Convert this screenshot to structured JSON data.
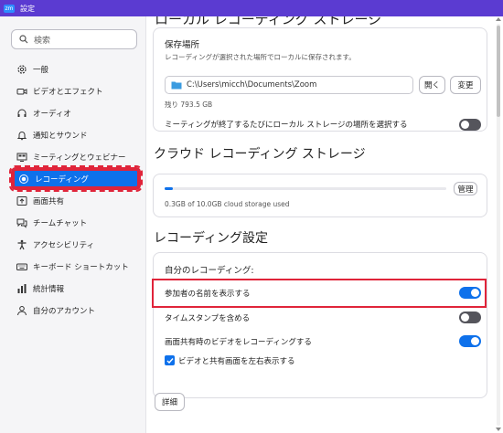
{
  "window": {
    "app_icon_text": "zm",
    "title": "設定"
  },
  "sidebar": {
    "search_placeholder": "検索",
    "items": [
      {
        "label": "一般",
        "icon": "gear-icon"
      },
      {
        "label": "ビデオとエフェクト",
        "icon": "video-camera-icon"
      },
      {
        "label": "オーディオ",
        "icon": "headphones-icon"
      },
      {
        "label": "通知とサウンド",
        "icon": "bell-icon"
      },
      {
        "label": "ミーティングとウェビナー",
        "icon": "meeting-icon"
      },
      {
        "label": "レコーディング",
        "icon": "record-icon",
        "active": true
      },
      {
        "label": "画面共有",
        "icon": "screen-share-icon"
      },
      {
        "label": "チームチャット",
        "icon": "chat-icon"
      },
      {
        "label": "アクセシビリティ",
        "icon": "accessibility-icon"
      },
      {
        "label": "キーボード ショートカット",
        "icon": "keyboard-icon"
      },
      {
        "label": "統計情報",
        "icon": "statistics-icon"
      },
      {
        "label": "自分のアカウント",
        "icon": "account-icon"
      }
    ]
  },
  "local": {
    "cut_heading": "ローカル レコーディング ストレージ",
    "title": "保存場所",
    "description": "レコーディングが選択された場所でローカルに保存されます。",
    "path": "C:\\Users\\micch\\Documents\\Zoom",
    "open_button": "開く",
    "change_button": "変更",
    "remaining": "残り 793.5 GB",
    "choose_location_label": "ミーティングが終了するたびにローカル ストレージの場所を選択する",
    "choose_location_enabled": false
  },
  "cloud": {
    "heading": "クラウド レコーディング ストレージ",
    "usage_text": "0.3GB of 10.0GB cloud storage used",
    "used_fraction": 0.03,
    "manage_button": "管理"
  },
  "recording_settings": {
    "heading": "レコーディング設定",
    "my_recording_label": "自分のレコーディング:",
    "options": [
      {
        "label": "参加者の名前を表示する",
        "enabled": true
      },
      {
        "label": "タイムスタンプを含める",
        "enabled": false
      },
      {
        "label": "画面共有時のビデオをレコーディングする",
        "enabled": true
      }
    ],
    "side_by_side_label": "ビデオと共有画面を左右表示する",
    "side_by_side_checked": true
  },
  "details_button": "詳細",
  "colors": {
    "accent": "#0e71eb",
    "highlight": "#e0243a",
    "titlebar": "#5b3bd1"
  }
}
